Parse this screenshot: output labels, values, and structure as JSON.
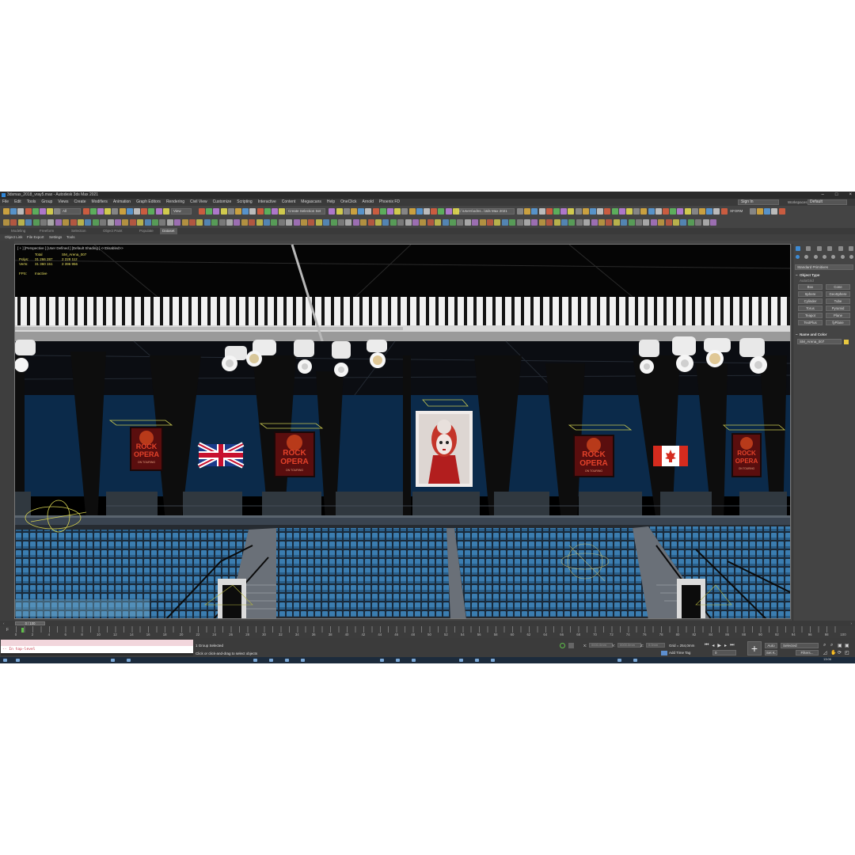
{
  "window": {
    "title": "3dsmax_2018_vray5.max - Autodesk 3ds Max 2021",
    "controls": [
      "–",
      "□",
      "×"
    ]
  },
  "menu": {
    "items": [
      "File",
      "Edit",
      "Tools",
      "Group",
      "Views",
      "Create",
      "Modifiers",
      "Animation",
      "Graph Editors",
      "Rendering",
      "Civil View",
      "Customize",
      "Scripting",
      "Interactive",
      "Content",
      "Megascans",
      "Help",
      "OneClick",
      "Arnold",
      "Phoenix FD"
    ],
    "signin": "Sign In",
    "workspaces_label": "Workspaces:",
    "workspace_value": "Default"
  },
  "toolbar": {
    "filter_value": "All",
    "view_value": "View",
    "selection_set": "Create Selection Set",
    "project_path": "C:\\Users\\odns...\\3ds Max 2021",
    "xform_label": "XFORM"
  },
  "ribbon": {
    "tabs": [
      "Modeling",
      "Freeform",
      "Selection",
      "Object Paint",
      "Populate",
      "Dataset"
    ],
    "active_index": 5
  },
  "sublinks": [
    "Object Link",
    "File Export",
    "Settings",
    "Tools"
  ],
  "viewport": {
    "label": "[ + ] [Perspective ] [User Defined ] [Default Shading ] <<Disabled>>",
    "stats": {
      "total_label": "Total",
      "object_name": "SM_Arena_007",
      "polys_label": "Polys:",
      "polys_total": "31 266 287",
      "polys_obj": "2 228 112",
      "verts_label": "Verts:",
      "verts_total": "31 360 151",
      "verts_obj": "2 396 956",
      "fps_label": "FPS:",
      "fps_value": "Inactive"
    },
    "banners": [
      "ROCK",
      "OPERA",
      "ON TOURING"
    ]
  },
  "command_panel": {
    "category": "Standard Primitives",
    "object_type": "Object Type",
    "autogrid": "AutoGrid",
    "buttons": [
      "Box",
      "Cone",
      "Sphere",
      "GeoSphere",
      "Cylinder",
      "Tube",
      "Torus",
      "Pyramid",
      "Teapot",
      "Plane",
      "TextPlus",
      "fyPlane"
    ],
    "name_color": "Name and Color",
    "object_name": "SM_Arena_007",
    "swatch_color": "#e8c840"
  },
  "timeline": {
    "position": "0 / 100",
    "frames": [
      "0",
      "2",
      "4",
      "6",
      "8",
      "10",
      "12",
      "14",
      "16",
      "18",
      "20",
      "22",
      "24",
      "26",
      "28",
      "30",
      "32",
      "34",
      "36",
      "38",
      "40",
      "42",
      "44",
      "46",
      "48",
      "50",
      "52",
      "54",
      "56",
      "58",
      "60",
      "62",
      "64",
      "66",
      "68",
      "70",
      "72",
      "74",
      "76",
      "78",
      "80",
      "82",
      "84",
      "86",
      "88",
      "90",
      "92",
      "94",
      "96",
      "98",
      "100"
    ]
  },
  "status": {
    "maxscript": "In top-level",
    "selected": "1 Group Selected",
    "prompt": "Click or click-and-drag to select objects",
    "x_label": "X:",
    "y_label": "Y:",
    "z_label": "Z:",
    "x_value": "0000.0mm",
    "y_value": "0000.0mm",
    "z_value": "0.0mm",
    "grid": "Grid = 254,0mm",
    "add_time_tag": "Add Time Tag",
    "auto": "Auto",
    "selected_mode": "Selected",
    "set_k": "Set K.",
    "filters": "Filters...",
    "frame": "0",
    "clock": "13:06"
  }
}
